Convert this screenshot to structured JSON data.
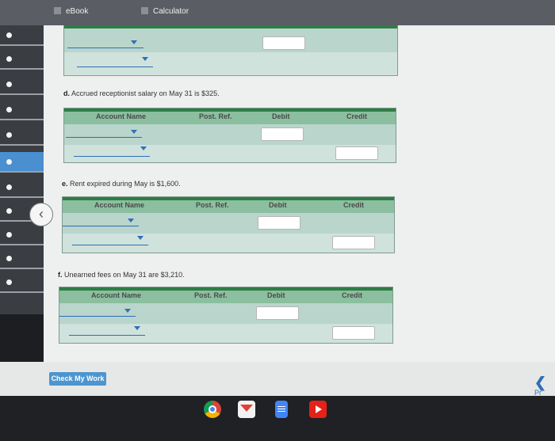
{
  "topbar": {
    "ebook_label": "eBook",
    "calculator_label": "Calculator"
  },
  "table_headers": {
    "account": "Account Name",
    "post_ref": "Post. Ref.",
    "debit": "Debit",
    "credit": "Credit"
  },
  "questions": {
    "d": {
      "letter": "d.",
      "text": "Accrued receptionist salary on May 31 is $325."
    },
    "e": {
      "letter": "e.",
      "text": "Rent expired during May is $1,600."
    },
    "f": {
      "letter": "f.",
      "text": "Unearned fees on May 31 are $3,210."
    }
  },
  "buttons": {
    "check_my_work": "Check My Work",
    "previous": "Pr"
  },
  "colors": {
    "table_header_green": "#8bbf9f",
    "header_border": "#2e7d45",
    "link_blue": "#2e6fb8",
    "button_blue": "#4d95d0"
  },
  "icons": [
    "chrome-icon",
    "gmail-icon",
    "docs-icon",
    "youtube-icon"
  ]
}
